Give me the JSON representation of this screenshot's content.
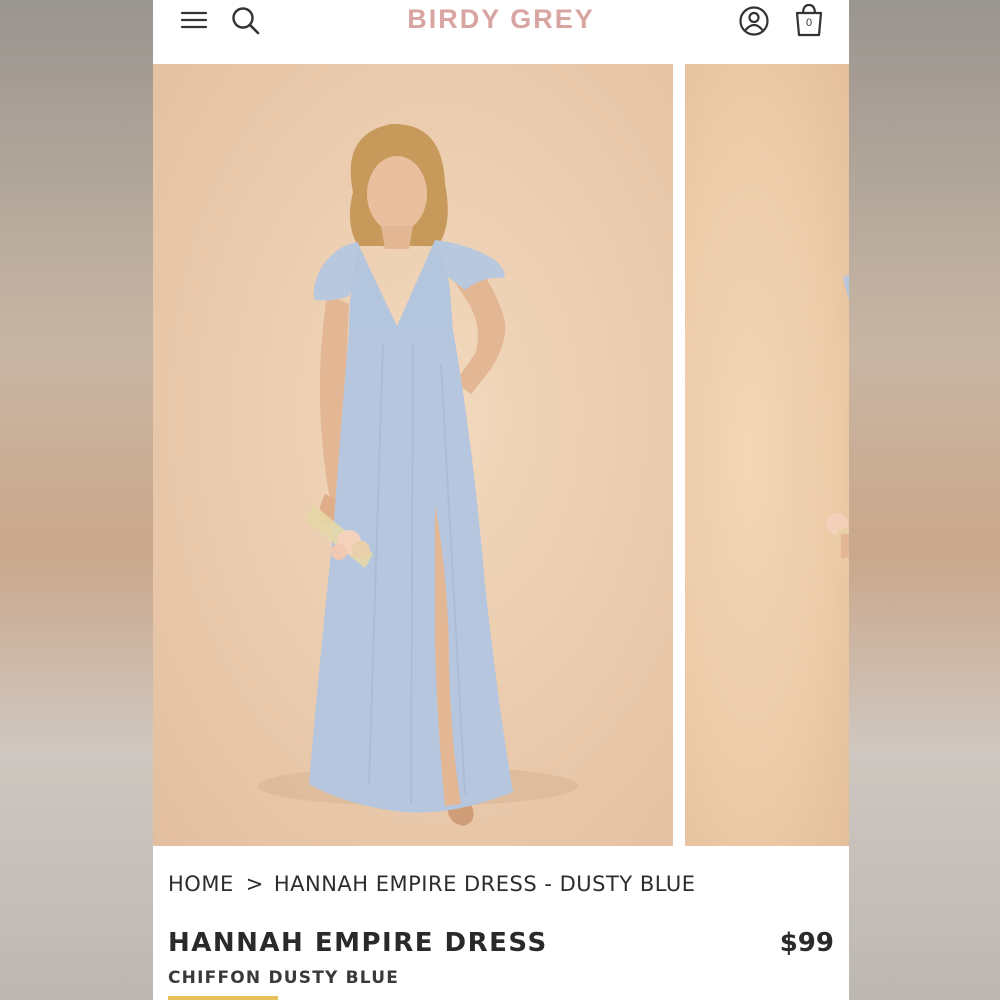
{
  "header": {
    "brand": "BIRDY GREY",
    "cart_count": "0",
    "icons": [
      "menu-icon",
      "search-icon",
      "account-icon",
      "shopping-bag-icon"
    ]
  },
  "breadcrumb": {
    "home": "HOME",
    "separator": ">",
    "current": "HANNAH EMPIRE DRESS - DUSTY BLUE"
  },
  "product": {
    "name": "HANNAH EMPIRE DRESS",
    "price": "$99",
    "variant": "CHIFFON DUSTY BLUE"
  },
  "colors": {
    "brand": "#d8a5a2",
    "dress": "#b6c6de",
    "backdrop": "#ecceb0"
  }
}
